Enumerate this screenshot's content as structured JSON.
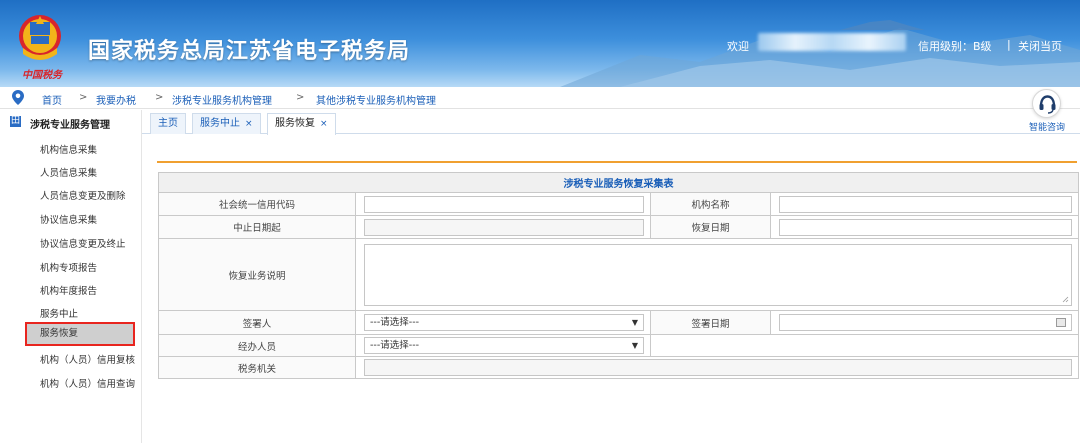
{
  "header": {
    "brand_script": "中国税务",
    "site_title": "国家税务总局江苏省电子税务局",
    "welcome_label": "欢迎",
    "credit_level": "信用级别：B级",
    "separator": "|",
    "close_page": "关闭当页"
  },
  "breadcrumb": {
    "items": [
      "首页",
      "我要办税",
      "涉税专业服务机构管理",
      "其他涉税专业服务机构管理"
    ],
    "arrow": ">"
  },
  "help": {
    "label": "智能咨询"
  },
  "sidebar": {
    "header_icon": "田",
    "title": "涉税专业服务管理",
    "items": [
      "机构信息采集",
      "人员信息采集",
      "人员信息变更及删除",
      "协议信息采集",
      "协议信息变更及终止",
      "机构专项报告",
      "机构年度报告",
      "服务中止",
      "服务恢复",
      "机构（人员）信用复核",
      "机构（人员）信用查询"
    ],
    "active_index": 8
  },
  "tabs": [
    {
      "label": "主页",
      "closable": false
    },
    {
      "label": "服务中止",
      "closable": true
    },
    {
      "label": "服务恢复",
      "closable": true
    }
  ],
  "tab_close_glyph": "×",
  "form": {
    "caption": "涉税专业服务恢复采集表",
    "labels": {
      "credit_code": "社会统一信用代码",
      "org_name": "机构名称",
      "suspend_start": "中止日期起",
      "restore_date": "恢复日期",
      "restore_desc": "恢复业务说明",
      "signer": "签署人",
      "sign_date": "签署日期",
      "handler": "经办人员",
      "tax_office": "税务机关"
    },
    "signer_select": "---请选择---",
    "handler_select": "---请选择---"
  },
  "colors": {
    "header_blue": "#2a78d0",
    "link_blue": "#1b5fb8",
    "accent_orange": "#f0a030",
    "highlight_red": "#e8251f"
  }
}
